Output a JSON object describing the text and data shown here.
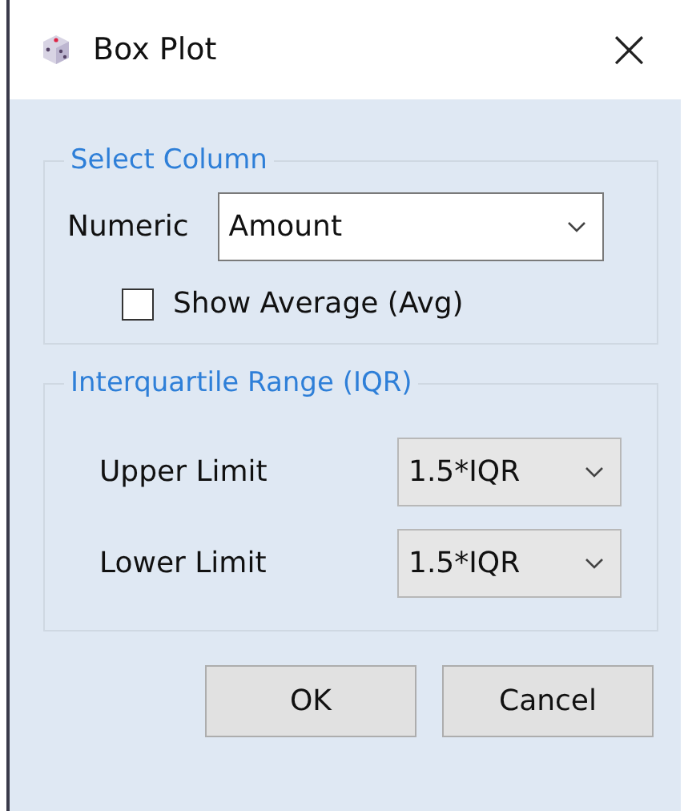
{
  "window": {
    "title": "Box Plot",
    "close": "×"
  },
  "select_column": {
    "legend": "Select Column",
    "numeric_label": "Numeric",
    "numeric_value": "Amount",
    "show_average": {
      "label": "Show Average (Avg)",
      "checked": false
    }
  },
  "iqr": {
    "legend": "Interquartile Range (IQR)",
    "rows": [
      {
        "label": "Upper Limit",
        "value": "1.5*IQR"
      },
      {
        "label": "Lower Limit",
        "value": "1.5*IQR"
      }
    ]
  },
  "buttons": [
    "OK",
    "Cancel"
  ]
}
